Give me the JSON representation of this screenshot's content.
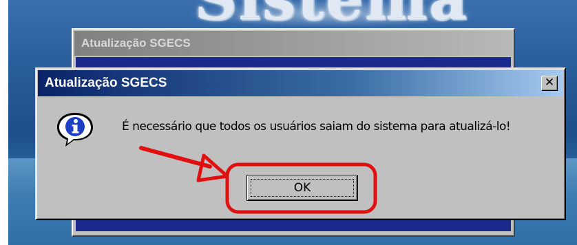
{
  "background": {
    "title_partial": "Sistema"
  },
  "back_window": {
    "title": "Atualização SGECS"
  },
  "dialog": {
    "title": "Atualização SGECS",
    "close_glyph": "✕",
    "icon": "info-icon",
    "message": "É necessário que todos os usuários saiam do sistema para atualizá-lo!",
    "ok_label": "OK"
  },
  "colors": {
    "titlebar_active": "#0a246a",
    "annotation": "#e01010"
  }
}
